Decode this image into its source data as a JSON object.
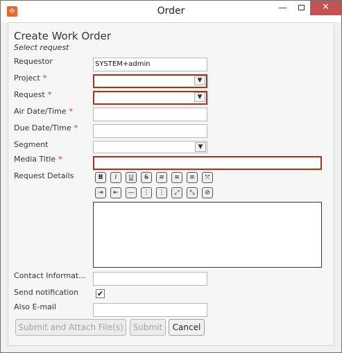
{
  "window": {
    "title": "Order",
    "app_icon": "orange-app-icon",
    "min_glyph": "—",
    "close_glyph": "✕"
  },
  "form": {
    "heading": "Create Work Order",
    "subheading": "Select request",
    "requestor": {
      "label": "Requestor",
      "value": "SYSTEM+admin"
    },
    "project": {
      "label": "Project",
      "required": "*",
      "value": ""
    },
    "request": {
      "label": "Request",
      "required": "*",
      "value": ""
    },
    "air_date": {
      "label": "Air Date/Time",
      "required": "*",
      "value": ""
    },
    "due_date": {
      "label": "Due Date/Time",
      "required": "*",
      "value": ""
    },
    "segment": {
      "label": "Segment",
      "value": ""
    },
    "media_title": {
      "label": "Media Title",
      "required": "*",
      "value": ""
    },
    "request_details": {
      "label": "Request Details"
    },
    "contact_info": {
      "label": "Contact Informat...",
      "value": ""
    },
    "send_notification": {
      "label": "Send notification",
      "checked": true,
      "check_glyph": "✔"
    },
    "also_email": {
      "label": "Also E-mail",
      "value": ""
    }
  },
  "toolbar_row1": [
    {
      "icon": "bold-icon",
      "glyph": "B"
    },
    {
      "icon": "italic-icon",
      "glyph": "I"
    },
    {
      "icon": "underline-icon",
      "glyph": "U"
    },
    {
      "icon": "strikethrough-icon",
      "glyph": "S"
    },
    {
      "icon": "align-left-icon",
      "glyph": "≡"
    },
    {
      "icon": "align-center-icon",
      "glyph": "≡"
    },
    {
      "icon": "align-right-icon",
      "glyph": "≡"
    },
    {
      "icon": "justify-icon",
      "glyph": "⤧"
    }
  ],
  "toolbar_row2": [
    {
      "icon": "indent-icon",
      "glyph": "⇥"
    },
    {
      "icon": "outdent-icon",
      "glyph": "⇤"
    },
    {
      "icon": "horizontal-rule-icon",
      "glyph": "—"
    },
    {
      "icon": "ordered-list-icon",
      "glyph": "⋮"
    },
    {
      "icon": "unordered-list-icon",
      "glyph": "⋮"
    },
    {
      "icon": "expand-icon",
      "glyph": "⤢"
    },
    {
      "icon": "shrink-icon",
      "glyph": "⤡"
    },
    {
      "icon": "clear-format-icon",
      "glyph": "⊘"
    }
  ],
  "buttons": {
    "submit_attach": "Submit and Attach File(s)",
    "submit": "Submit",
    "cancel": "Cancel"
  },
  "colors": {
    "error_border": "#a4341a",
    "required_asterisk": "#c0392b",
    "close_button": "#c75050",
    "app_icon": "#e9662c"
  }
}
